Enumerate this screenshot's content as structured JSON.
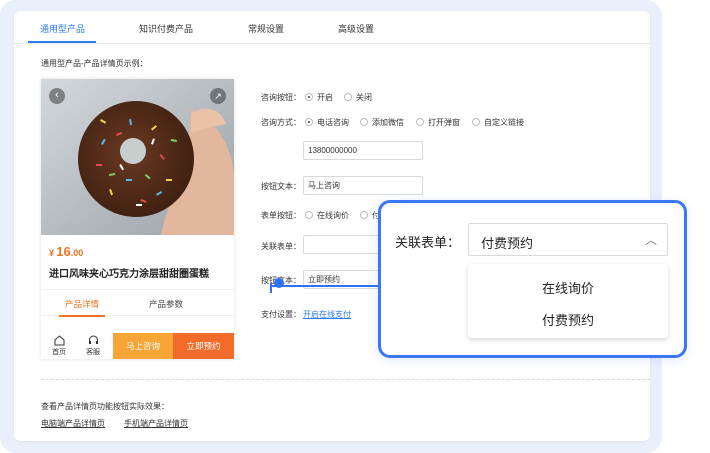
{
  "tabs": [
    {
      "label": "通用型产品",
      "active": true
    },
    {
      "label": "知识付费产品",
      "active": false
    },
    {
      "label": "常规设置",
      "active": false
    },
    {
      "label": "高级设置",
      "active": false
    }
  ],
  "example_title": "通用型产品-产品详情页示例：",
  "preview": {
    "price_currency": "¥",
    "price_int": "16",
    "price_dec": ".00",
    "product_name": "进口风味夹心巧克力涂层甜甜圈蛋糕",
    "tabs": [
      "产品详情",
      "产品参数"
    ],
    "bottom": {
      "home": "首页",
      "service": "客服",
      "ask": "马上咨询",
      "book": "立即预约"
    }
  },
  "form": {
    "consult_button": {
      "label": "咨询按钮：",
      "options": [
        "开启",
        "关闭"
      ],
      "selected": "开启"
    },
    "consult_method": {
      "label": "咨询方式：",
      "options": [
        "电话咨询",
        "添加微信",
        "打开弹窗",
        "自定义链接"
      ],
      "selected": "电话咨询",
      "phone_value": "13800000000"
    },
    "button_text_1": {
      "label": "按钮文本：",
      "value": "马上咨询"
    },
    "form_button": {
      "label": "表单按钮：",
      "options": [
        "在线询价",
        "付"
      ]
    },
    "linked_form": {
      "label": "关联表单："
    },
    "button_text_2": {
      "label": "按钮文本：",
      "value": "立即预约"
    },
    "payment": {
      "label": "支付设置：",
      "link": "开启在线支付"
    }
  },
  "bottom_note": "查看产品详情页功能按钮实际效果：",
  "bottom_links": [
    "电脑端产品详情页",
    "手机端产品详情页"
  ],
  "callout": {
    "label": "关联表单：",
    "selected": "付费预约",
    "options": [
      "在线询价",
      "付费预约"
    ]
  },
  "colors": {
    "accent": "#2c7cf6",
    "orange": "#f2731f",
    "ask_btn": "#f7a536",
    "book_btn": "#f26b2a"
  }
}
